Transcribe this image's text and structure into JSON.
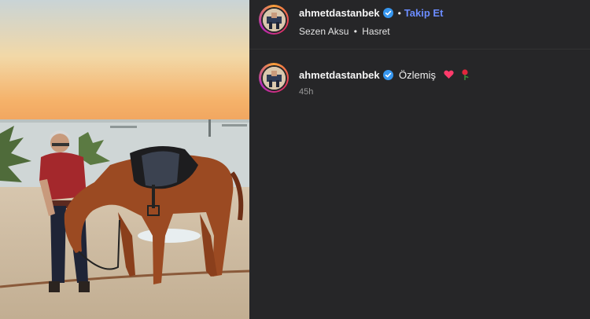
{
  "post": {
    "username": "ahmetdastanbek",
    "follow_label": "Takip Et",
    "separator": "•",
    "music": {
      "artist": "Sezen Aksu",
      "separator": "•",
      "song": "Hasret"
    }
  },
  "caption": {
    "username": "ahmetdastanbek",
    "text": "Özlemiş",
    "emojis": [
      "heart-icon",
      "rose-icon"
    ],
    "time": "45h"
  },
  "colors": {
    "panel_bg": "#262628",
    "follow_link": "#6b8cff",
    "verified_badge": "#3797f0",
    "heart": "#ff3b6b"
  }
}
